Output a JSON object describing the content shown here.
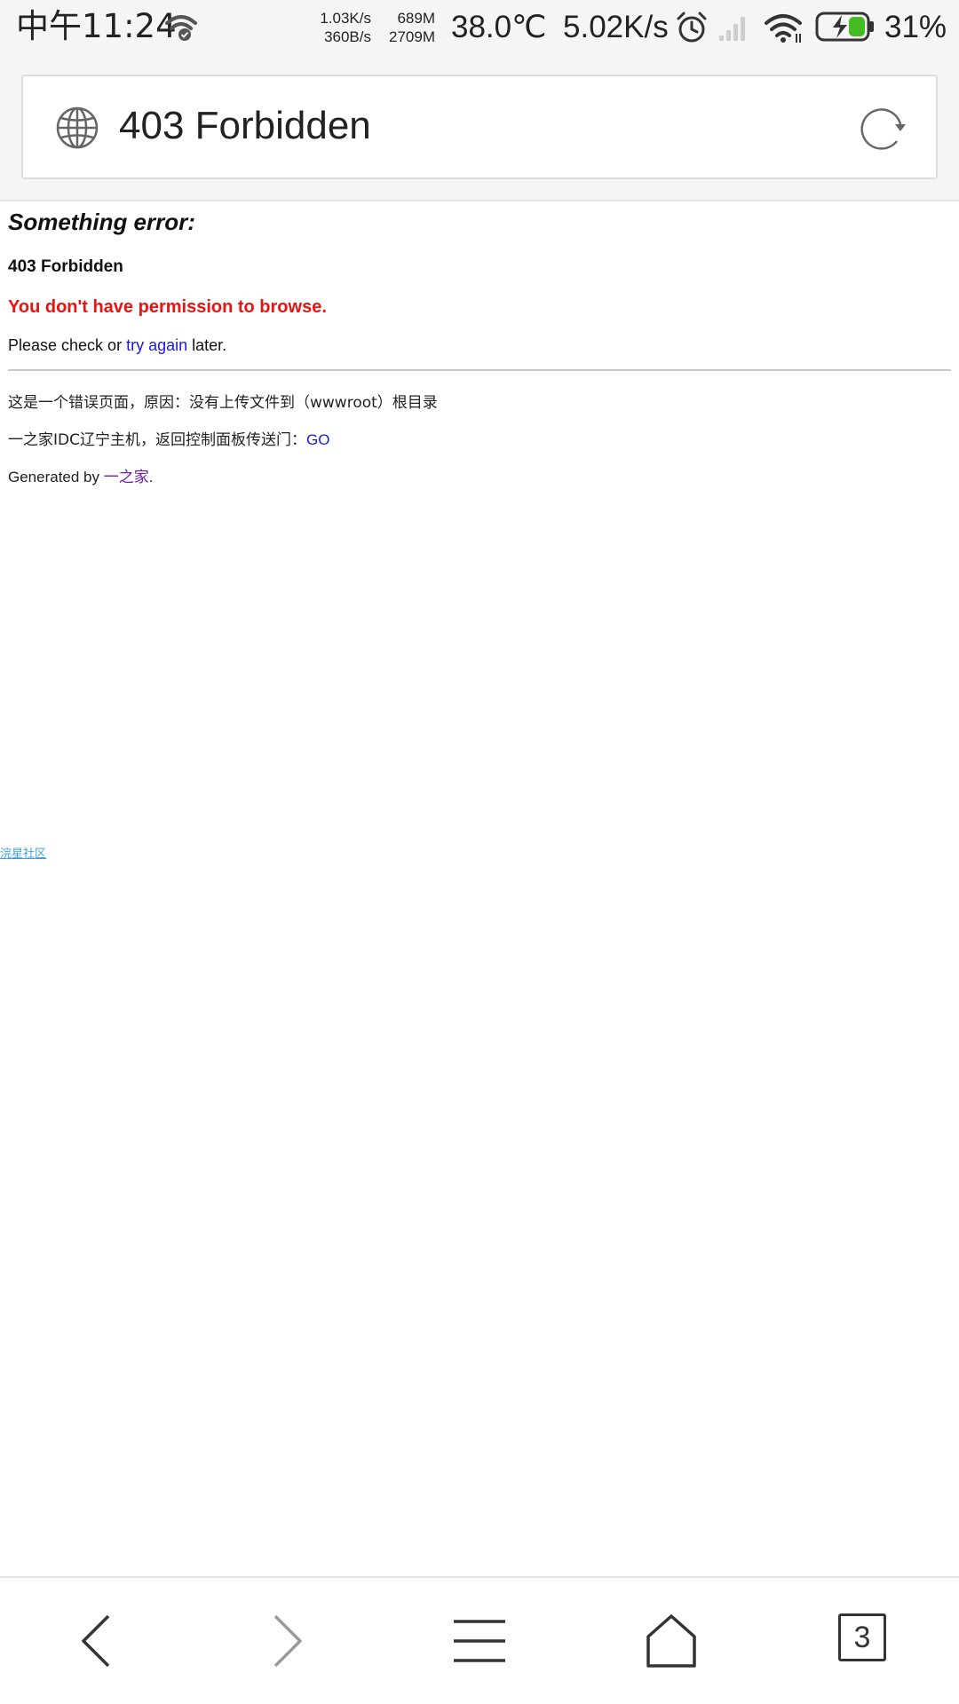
{
  "status_bar": {
    "time": "中午11:24",
    "net_up": "1.03K/s",
    "net_down": "360B/s",
    "mem_used": "689M",
    "mem_total": "2709M",
    "temperature": "38.0℃",
    "rate": "5.02K/s",
    "battery_percent": "31%",
    "icons": [
      "wifi-check-icon",
      "alarm-icon",
      "signal-icon",
      "wifi-icon",
      "battery-charging-icon"
    ],
    "battery_fill_fraction": 0.31,
    "battery_color": "#44bb22"
  },
  "address_bar": {
    "title": "403 Forbidden",
    "icons": [
      "globe-icon",
      "reload-icon"
    ]
  },
  "page": {
    "heading": "Something error:",
    "code": "403 Forbidden",
    "message": "You don't have permission to browse.",
    "hint_before": "Please check or ",
    "hint_link": "try again",
    "hint_after": " later.",
    "info_1": "这是一个错误页面，原因：没有上传文件到（wwwroot）根目录",
    "info_2_text": "一之家IDC辽宁主机，返回控制面板传送门：",
    "info_2_link": "GO",
    "generated_before": "Generated by ",
    "generated_link": "一之家",
    "generated_after": ".",
    "float_link": "浣星社区",
    "colors": {
      "error_red": "#ee1111",
      "link_blue": "#1a1add",
      "visited_purple": "#6b1fa8",
      "float_link": "#3aa0e6"
    }
  },
  "toolbar": {
    "tab_count": "3",
    "icons": [
      "back-icon",
      "forward-icon",
      "menu-icon",
      "home-icon",
      "tabs-icon"
    ]
  }
}
